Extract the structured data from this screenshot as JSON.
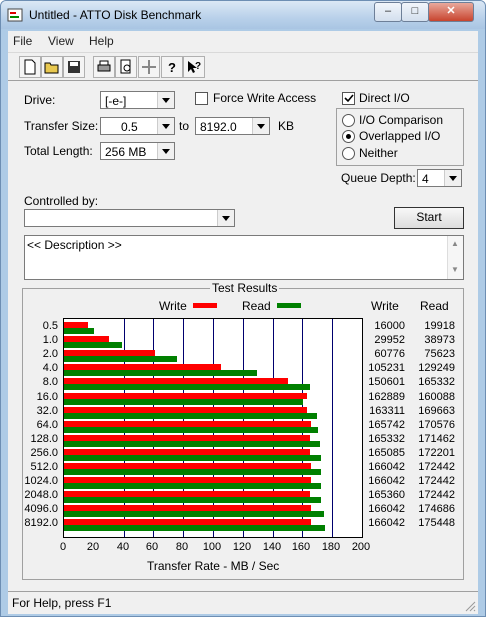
{
  "window": {
    "title": "Untitled - ATTO Disk Benchmark",
    "minimize_icon": "minimize-icon",
    "maximize_icon": "maximize-icon",
    "close_icon": "close-icon"
  },
  "menu": {
    "file": "File",
    "view": "View",
    "help": "Help"
  },
  "toolbar": {
    "icons": [
      "new-document-icon",
      "open-folder-icon",
      "save-icon",
      "print-icon",
      "print-preview-icon",
      "move-icon",
      "help-icon",
      "context-help-icon"
    ]
  },
  "settings": {
    "drive_label": "Drive:",
    "drive_value": "[-e-]",
    "force_write_label": "Force Write Access",
    "direct_io_label": "Direct I/O",
    "direct_io_checked": true,
    "transfer_size_label": "Transfer Size:",
    "transfer_from": "0.5",
    "to_label": "to",
    "transfer_to": "8192.0",
    "kb_label": "KB",
    "total_length_label": "Total Length:",
    "total_length_value": "256 MB",
    "io_comparison_label": "I/O Comparison",
    "overlapped_io_label": "Overlapped I/O",
    "neither_label": "Neither",
    "selected_mode": "Overlapped I/O",
    "queue_depth_label": "Queue Depth:",
    "queue_depth_value": "4",
    "controlled_by_label": "Controlled by:",
    "controlled_by_value": "",
    "start_label": "Start",
    "description": "<< Description >>"
  },
  "results": {
    "group_title": "Test Results",
    "write_legend": "Write",
    "read_legend": "Read",
    "write_header": "Write",
    "read_header": "Read",
    "xlabel": "Transfer Rate - MB / Sec",
    "write_color": "#ff0000",
    "read_color": "#008000",
    "rows": [
      {
        "size": "0.5",
        "write": "16000",
        "read": "19918"
      },
      {
        "size": "1.0",
        "write": "29952",
        "read": "38973"
      },
      {
        "size": "2.0",
        "write": "60776",
        "read": "75623"
      },
      {
        "size": "4.0",
        "write": "105231",
        "read": "129249"
      },
      {
        "size": "8.0",
        "write": "150601",
        "read": "165332"
      },
      {
        "size": "16.0",
        "write": "162889",
        "read": "160088"
      },
      {
        "size": "32.0",
        "write": "163311",
        "read": "169663"
      },
      {
        "size": "64.0",
        "write": "165742",
        "read": "170576"
      },
      {
        "size": "128.0",
        "write": "165332",
        "read": "171462"
      },
      {
        "size": "256.0",
        "write": "165085",
        "read": "172201"
      },
      {
        "size": "512.0",
        "write": "166042",
        "read": "172442"
      },
      {
        "size": "1024.0",
        "write": "166042",
        "read": "172442"
      },
      {
        "size": "2048.0",
        "write": "165360",
        "read": "172442"
      },
      {
        "size": "4096.0",
        "write": "166042",
        "read": "174686"
      },
      {
        "size": "8192.0",
        "write": "166042",
        "read": "175448"
      }
    ]
  },
  "chart_data": {
    "type": "bar",
    "orientation": "horizontal",
    "categories": [
      "0.5",
      "1.0",
      "2.0",
      "4.0",
      "8.0",
      "16.0",
      "32.0",
      "64.0",
      "128.0",
      "256.0",
      "512.0",
      "1024.0",
      "2048.0",
      "4096.0",
      "8192.0"
    ],
    "series": [
      {
        "name": "Write",
        "values": [
          16.0,
          30.0,
          60.8,
          105.2,
          150.6,
          162.9,
          163.3,
          165.7,
          165.3,
          165.1,
          166.0,
          166.0,
          165.4,
          166.0,
          166.0
        ]
      },
      {
        "name": "Read",
        "values": [
          19.9,
          39.0,
          75.6,
          129.2,
          165.3,
          160.1,
          169.7,
          170.6,
          171.5,
          172.2,
          172.4,
          172.4,
          172.4,
          174.7,
          175.4
        ]
      }
    ],
    "xlabel": "Transfer Rate - MB / Sec",
    "xticks": [
      "0",
      "20",
      "40",
      "60",
      "80",
      "100",
      "120",
      "140",
      "160",
      "180",
      "200"
    ],
    "xlim": [
      0,
      200
    ]
  },
  "status": {
    "text": "For Help, press F1"
  }
}
